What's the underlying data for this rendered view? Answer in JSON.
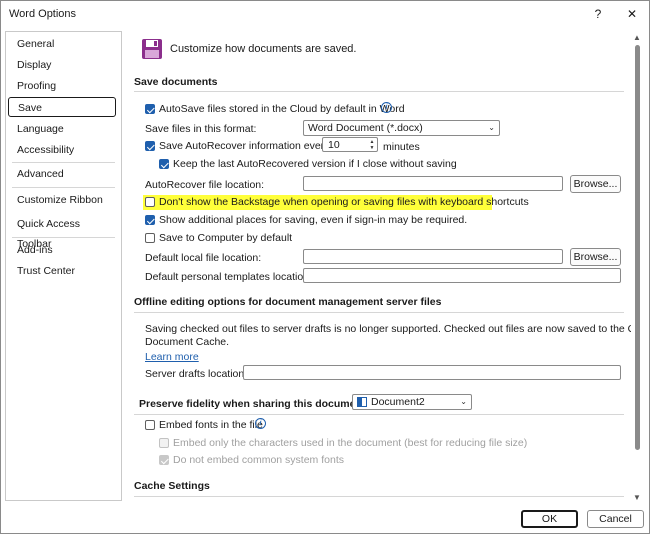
{
  "window": {
    "title": "Word Options",
    "help_glyph": "?",
    "close_glyph": "✕"
  },
  "sidebar": {
    "items": [
      {
        "label": "General"
      },
      {
        "label": "Display"
      },
      {
        "label": "Proofing"
      },
      {
        "label": "Save",
        "selected": true
      },
      {
        "label": "Language"
      },
      {
        "label": "Accessibility"
      },
      {
        "label": "Advanced"
      },
      {
        "label": "Customize Ribbon"
      },
      {
        "label": "Quick Access Toolbar"
      },
      {
        "label": "Add-ins"
      },
      {
        "label": "Trust Center"
      }
    ]
  },
  "header": {
    "icon": "floppy-disk-icon",
    "text": "Customize how documents are saved."
  },
  "save_documents": {
    "heading": "Save documents",
    "autosave_cloud": {
      "label": "AutoSave files stored in the Cloud by default in Word",
      "checked": true
    },
    "format_label": "Save files in this format:",
    "format_value": "Word Document (*.docx)",
    "autorecover": {
      "label": "Save AutoRecover information every",
      "checked": true
    },
    "autorecover_minutes": "10",
    "minutes_label": "minutes",
    "keep_last": {
      "label": "Keep the last AutoRecovered version if I close without saving",
      "checked": true
    },
    "autorecover_location_label": "AutoRecover file location:",
    "autorecover_location_value": "",
    "browse1": "Browse...",
    "dont_show_backstage": {
      "label": "Don't show the Backstage when opening or saving files with keyboard shortcuts",
      "checked": false,
      "highlight_color": "#ffff3a"
    },
    "show_additional": {
      "label": "Show additional places for saving, even if sign-in may be required.",
      "checked": true
    },
    "save_to_computer": {
      "label": "Save to Computer by default",
      "checked": false
    },
    "default_local_label": "Default local file location:",
    "default_local_value": "",
    "browse2": "Browse...",
    "default_templates_label": "Default personal templates location:",
    "default_templates_value": ""
  },
  "offline": {
    "heading": "Offline editing options for document management server files",
    "message_line1": "Saving checked out files to server drafts is no longer supported. Checked out files are now saved to the Office",
    "message_line2": "Document Cache.",
    "learn_more": "Learn more",
    "server_drafts_label": "Server drafts location:",
    "server_drafts_value": ""
  },
  "fidelity": {
    "heading": "Preserve fidelity when sharing this document:",
    "document": "Document2",
    "embed_fonts": {
      "label": "Embed fonts in the file",
      "checked": false
    },
    "embed_only_used": {
      "label": "Embed only the characters used in the document (best for reducing file size)",
      "checked": false,
      "disabled": true
    },
    "no_common_fonts": {
      "label": "Do not embed common system fonts",
      "checked": true,
      "disabled": true
    }
  },
  "cache": {
    "heading": "Cache Settings"
  },
  "footer": {
    "ok": "OK",
    "cancel": "Cancel"
  },
  "colors": {
    "accent": "#1f5fad",
    "highlight": "#ffff3a",
    "floppy": "#8b2e8c"
  }
}
